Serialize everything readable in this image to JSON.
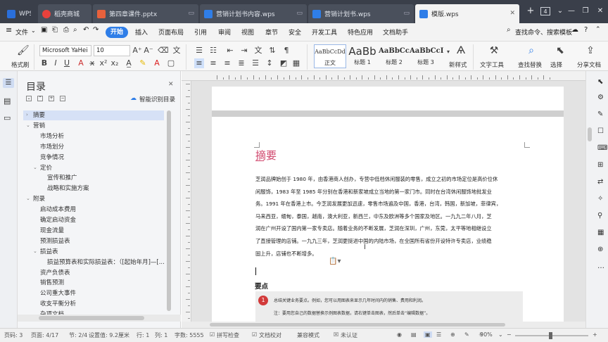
{
  "tabs": [
    {
      "label": "WPS",
      "icon": "wps-logo-icon",
      "color": "#2a6fdb"
    },
    {
      "label": "稻壳商城",
      "icon": "docer-icon",
      "color": "#e8413c"
    },
    {
      "label": "第四章课件.pptx",
      "icon": "ppt-icon",
      "color": "#e8613c"
    },
    {
      "label": "营销计划书内容.wps",
      "icon": "wps-doc-icon",
      "color": "#2f7ee8"
    },
    {
      "label": "营销计划书.wps",
      "icon": "wps-doc-icon",
      "color": "#2f7ee8"
    },
    {
      "label": "模版.wps",
      "icon": "wps-doc-icon",
      "color": "#2f7ee8"
    }
  ],
  "tabbar": {
    "add": "+",
    "count": "4"
  },
  "menu": {
    "file": "文件",
    "start": "开始",
    "items": [
      "插入",
      "页面布局",
      "引用",
      "审阅",
      "视图",
      "章节",
      "安全",
      "开发工具",
      "特色应用",
      "文档助手"
    ],
    "search": "查找命令、搜索模板"
  },
  "ribbon": {
    "format_painter": "格式刷",
    "font": "Microsoft YaHei",
    "size": "10",
    "styles": [
      {
        "preview": "AaBbCcDd",
        "label": "正文"
      },
      {
        "preview": "AaBb",
        "label": "标题 1"
      },
      {
        "preview": "AaBbCc",
        "label": "标题 2"
      },
      {
        "preview": "AaBbCcI",
        "label": "标题 3"
      }
    ],
    "new_style": "新样式",
    "text_tools": "文字工具",
    "find_replace": "查找替换",
    "select": "选择",
    "share": "分享文档"
  },
  "toc": {
    "title": "目录",
    "smart": "智能识别目录",
    "items": [
      {
        "label": "摘要",
        "level": 0,
        "arrow": "›",
        "selected": true
      },
      {
        "label": "营销",
        "level": 0,
        "arrow": "⌄"
      },
      {
        "label": "市场分析",
        "level": 1
      },
      {
        "label": "市场划分",
        "level": 1
      },
      {
        "label": "竞争情况",
        "level": 1
      },
      {
        "label": "定价",
        "level": 1,
        "arrow": "⌄"
      },
      {
        "label": "宣传和推广",
        "level": 2
      },
      {
        "label": "战略和实施方案",
        "level": 2
      },
      {
        "label": "附录",
        "level": 0,
        "arrow": "⌄"
      },
      {
        "label": "启动成本费用",
        "level": 1
      },
      {
        "label": "确定启动资金",
        "level": 1
      },
      {
        "label": "现金流量",
        "level": 1
      },
      {
        "label": "预测损益表",
        "level": 1
      },
      {
        "label": "损益表",
        "level": 1,
        "arrow": "⌄"
      },
      {
        "label": "损益预算表和实际损益表：（[起始年月]—[...",
        "level": 2
      },
      {
        "label": "资产负债表",
        "level": 1
      },
      {
        "label": "销售预测",
        "level": 1
      },
      {
        "label": "公司重大事件",
        "level": 1
      },
      {
        "label": "收支平衡分析",
        "level": 1
      },
      {
        "label": "杂项文档",
        "level": 1
      }
    ]
  },
  "doc": {
    "heading": "摘要",
    "lines": [
      "芝润品牌始创于 1980 年，由香港商人创办，专营中低档休闲服装的零售，成立之初的市场定位是高价位休",
      "闲服饰，1983 年至 1985 年分别在香港和新家坡成立当地的第一家门市。同时在台湾休闲服饰地批发业",
      "务。1991 年在香港上市。今芝润发展更加迅速，零售市场遍及中国，香港，台湾，韩国，新加坡，菲律宾，",
      "马来西亚，缅甸，泰国，越南，澳大利亚，新西兰，中东及欧洲等多个国家及地区。一九九二年八月，芝",
      "润在广州开设了国内第一家专卖店。随着业务的不断发展，芝润在深圳，广州，东莞，太平等地相继设立",
      "了直接管理的店铺。一九九三年，芝润更挺进中国的内陆市场，在全国所有省份开设特许专卖店，业绩稳",
      "固上升，店铺也不断增多。"
    ],
    "subheading": "要点",
    "note_number": "1",
    "note1": "总结关键业务要点。例如，您可以用图表来显示几年时间内的销售、费用和利润。",
    "note2": "注：要用您自己的数据替换示例图表数据，请右键单击图表，然后单击“编辑数据”。"
  },
  "status": {
    "page": "页码: 3",
    "pages": "页面: 4/17",
    "section": "节: 2/4",
    "setting": "设置值: 9.2厘米",
    "row": "行: 1",
    "col": "列: 1",
    "words": "字数: 5555",
    "spell": "拼写检查",
    "proof": "文档校对",
    "compat": "兼容模式",
    "unauth": "未认证",
    "zoom": "90%"
  },
  "colors": {
    "accent": "#2f7ee8",
    "heading": "#d0466c",
    "note_red": "#d23a3a"
  }
}
